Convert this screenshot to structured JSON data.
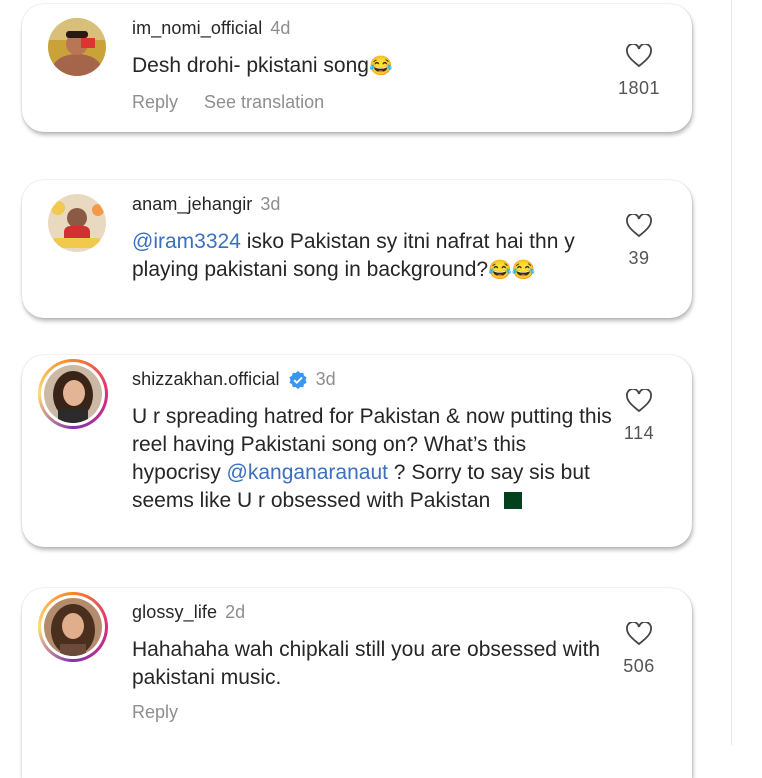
{
  "comments": [
    {
      "username": "im_nomi_official",
      "time": "4d",
      "verified": false,
      "text": "Desh drohi- pkistani song",
      "emoji": "😂",
      "actions": [
        "Reply",
        "See translation"
      ],
      "likes": "1801"
    },
    {
      "username": "anam_jehangir",
      "time": "3d",
      "verified": false,
      "mention": "@iram3324",
      "text": " isko Pakistan sy itni nafrat hai thn y playing pakistani song in background?",
      "emoji": "😂😂",
      "likes": "39"
    },
    {
      "username": "shizzakhan.official",
      "time": "3d",
      "verified": true,
      "text_before": "U r spreading hatred for Pakistan & now putting this reel having Pakistani song on? What’s this hypocrisy ",
      "mention": "@kanganaranaut",
      "text_after": " ? Sorry to say sis but seems like U r obsessed with Pakistan ",
      "flag": "pakistan-flag-emoji",
      "likes": "114"
    },
    {
      "username": "glossy_life",
      "time": "2d",
      "verified": false,
      "text": "Hahahaha wah chipkali still you are obsessed with pakistani music.",
      "actions": [
        "Reply"
      ],
      "likes": "506"
    }
  ],
  "colors": {
    "mention": "#3b6fbf",
    "muted": "#8e8e8e",
    "text": "#262626",
    "verified": "#3897f0"
  }
}
